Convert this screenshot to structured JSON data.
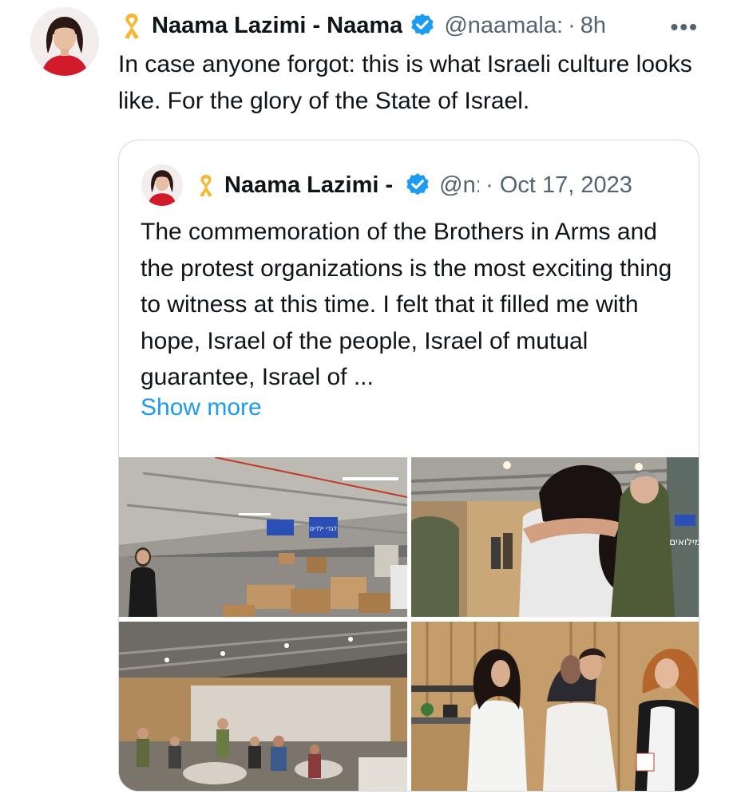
{
  "tweet": {
    "author_name": "Naama Lazimi - Naama",
    "handle": "@naamala:",
    "separator": "·",
    "time": "8h",
    "more": "•••",
    "text": "In case anyone forgot: this is what Israeli culture looks like. For the glory of the State of Israel."
  },
  "quoted_tweet": {
    "author_name": "Naama Lazimi -",
    "handle": "@n:",
    "separator": "·",
    "date": "Oct 17, 2023",
    "text": "The commemoration of the Brothers in Arms and the protest organizations is the most exciting thing to witness at this time. I felt that it filled me with hope, Israel of the people, Israel of mutual guarantee, Israel of ...",
    "show_more": "Show more"
  },
  "photos": [
    {
      "sign_a": "לגדי ילדים"
    },
    {
      "shirt": "מילואים"
    },
    {},
    {}
  ],
  "colors": {
    "accent": "#1d9bf0",
    "secondary_text": "#536471",
    "ribbon": "#f7b733",
    "border": "#cfd9de"
  },
  "icons": [
    "yellow-ribbon-icon",
    "verified-badge-icon",
    "more-options-icon"
  ]
}
